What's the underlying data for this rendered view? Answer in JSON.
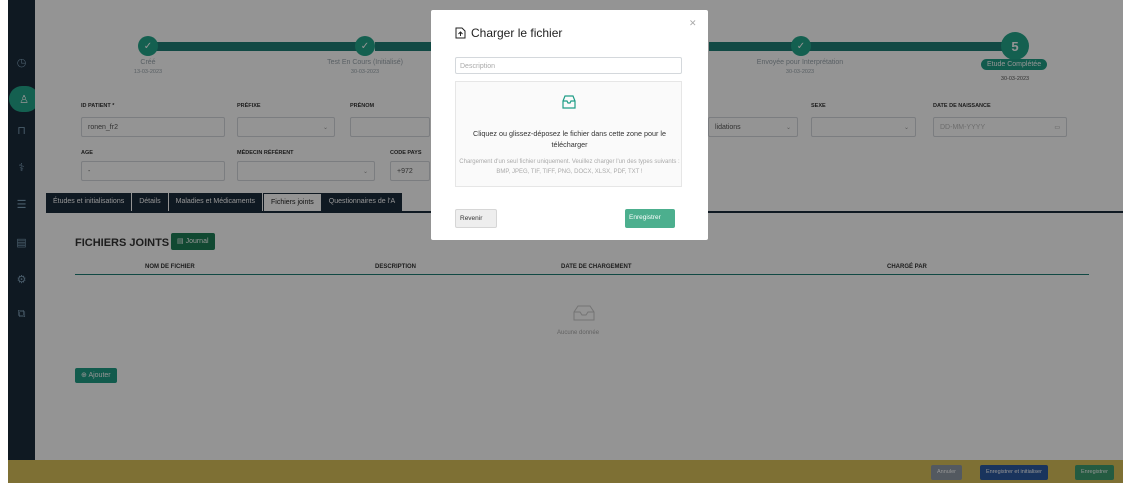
{
  "stepper": {
    "steps": [
      {
        "label": "Créé",
        "date": "13-03-2023"
      },
      {
        "label": "Test En Cours (Initialisé)",
        "date": "30-03-2023"
      },
      {
        "label": "Envoyée pour Interprétation",
        "date": "30-03-2023"
      },
      {
        "label": "Etude Complétée",
        "date": "30-03-2023",
        "number": "5"
      }
    ],
    "check": "✓"
  },
  "form": {
    "patient_id_label": "ID PATIENT *",
    "patient_id_value": "ronen_fr2",
    "prefix_label": "PRÉFIXE",
    "first_name_label": "PRÉNOM",
    "sex_label": "SEXE",
    "birth_label": "DATE DE NAISSANCE",
    "birth_placeholder": "DD-MM-YYYY",
    "validations_value": "lidations",
    "age_label": "AGE",
    "age_value": "-",
    "doctor_label": "MÉDECIN RÉFÉRENT",
    "country_code_label": "CODE PAYS",
    "country_code_value": "+972"
  },
  "tabs": [
    "Études et initialisations",
    "Détails",
    "Maladies et Médicaments",
    "Fichiers joints",
    "Questionnaires de l'A"
  ],
  "files": {
    "title": "FICHIERS JOINTS",
    "journal_btn": "Journal",
    "columns": [
      "NOM DE FICHIER",
      "DESCRIPTION",
      "DATE DE CHARGEMENT",
      "CHARGÉ PAR"
    ],
    "empty": "Aucune donnée",
    "add_btn": "Ajouter"
  },
  "footer": {
    "cancel": "Annuler",
    "save_init": "Enregistrer et initialiser",
    "save": "Enregistrer"
  },
  "modal": {
    "title": "Charger le fichier",
    "description_placeholder": "Description",
    "drop_main": "Cliquez ou glissez-déposez le fichier dans cette zone pour le télécharger",
    "drop_sub": "Chargement d'un seul fichier uniquement. Veuillez charger l'un des types suivants : BMP, JPEG, TIF, TIFF, PNG, DOCX, XLSX, PDF, TXT !",
    "back_btn": "Revenir",
    "save_btn": "Enregistrer"
  }
}
